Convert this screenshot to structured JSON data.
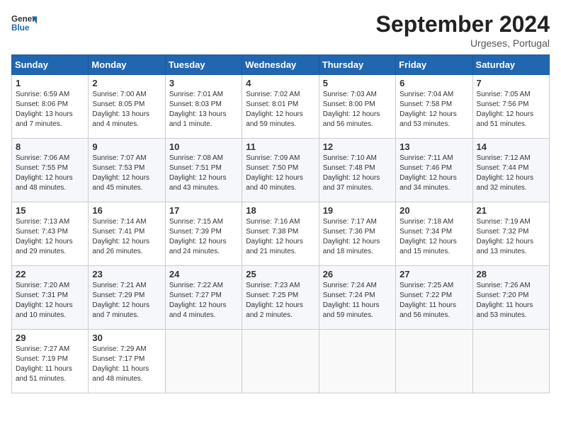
{
  "header": {
    "logo_line1": "General",
    "logo_line2": "Blue",
    "month_title": "September 2024",
    "location": "Urgeses, Portugal"
  },
  "days_of_week": [
    "Sunday",
    "Monday",
    "Tuesday",
    "Wednesday",
    "Thursday",
    "Friday",
    "Saturday"
  ],
  "weeks": [
    [
      {
        "day": "1",
        "sunrise": "Sunrise: 6:59 AM",
        "sunset": "Sunset: 8:06 PM",
        "daylight": "Daylight: 13 hours and 7 minutes."
      },
      {
        "day": "2",
        "sunrise": "Sunrise: 7:00 AM",
        "sunset": "Sunset: 8:05 PM",
        "daylight": "Daylight: 13 hours and 4 minutes."
      },
      {
        "day": "3",
        "sunrise": "Sunrise: 7:01 AM",
        "sunset": "Sunset: 8:03 PM",
        "daylight": "Daylight: 13 hours and 1 minute."
      },
      {
        "day": "4",
        "sunrise": "Sunrise: 7:02 AM",
        "sunset": "Sunset: 8:01 PM",
        "daylight": "Daylight: 12 hours and 59 minutes."
      },
      {
        "day": "5",
        "sunrise": "Sunrise: 7:03 AM",
        "sunset": "Sunset: 8:00 PM",
        "daylight": "Daylight: 12 hours and 56 minutes."
      },
      {
        "day": "6",
        "sunrise": "Sunrise: 7:04 AM",
        "sunset": "Sunset: 7:58 PM",
        "daylight": "Daylight: 12 hours and 53 minutes."
      },
      {
        "day": "7",
        "sunrise": "Sunrise: 7:05 AM",
        "sunset": "Sunset: 7:56 PM",
        "daylight": "Daylight: 12 hours and 51 minutes."
      }
    ],
    [
      {
        "day": "8",
        "sunrise": "Sunrise: 7:06 AM",
        "sunset": "Sunset: 7:55 PM",
        "daylight": "Daylight: 12 hours and 48 minutes."
      },
      {
        "day": "9",
        "sunrise": "Sunrise: 7:07 AM",
        "sunset": "Sunset: 7:53 PM",
        "daylight": "Daylight: 12 hours and 45 minutes."
      },
      {
        "day": "10",
        "sunrise": "Sunrise: 7:08 AM",
        "sunset": "Sunset: 7:51 PM",
        "daylight": "Daylight: 12 hours and 43 minutes."
      },
      {
        "day": "11",
        "sunrise": "Sunrise: 7:09 AM",
        "sunset": "Sunset: 7:50 PM",
        "daylight": "Daylight: 12 hours and 40 minutes."
      },
      {
        "day": "12",
        "sunrise": "Sunrise: 7:10 AM",
        "sunset": "Sunset: 7:48 PM",
        "daylight": "Daylight: 12 hours and 37 minutes."
      },
      {
        "day": "13",
        "sunrise": "Sunrise: 7:11 AM",
        "sunset": "Sunset: 7:46 PM",
        "daylight": "Daylight: 12 hours and 34 minutes."
      },
      {
        "day": "14",
        "sunrise": "Sunrise: 7:12 AM",
        "sunset": "Sunset: 7:44 PM",
        "daylight": "Daylight: 12 hours and 32 minutes."
      }
    ],
    [
      {
        "day": "15",
        "sunrise": "Sunrise: 7:13 AM",
        "sunset": "Sunset: 7:43 PM",
        "daylight": "Daylight: 12 hours and 29 minutes."
      },
      {
        "day": "16",
        "sunrise": "Sunrise: 7:14 AM",
        "sunset": "Sunset: 7:41 PM",
        "daylight": "Daylight: 12 hours and 26 minutes."
      },
      {
        "day": "17",
        "sunrise": "Sunrise: 7:15 AM",
        "sunset": "Sunset: 7:39 PM",
        "daylight": "Daylight: 12 hours and 24 minutes."
      },
      {
        "day": "18",
        "sunrise": "Sunrise: 7:16 AM",
        "sunset": "Sunset: 7:38 PM",
        "daylight": "Daylight: 12 hours and 21 minutes."
      },
      {
        "day": "19",
        "sunrise": "Sunrise: 7:17 AM",
        "sunset": "Sunset: 7:36 PM",
        "daylight": "Daylight: 12 hours and 18 minutes."
      },
      {
        "day": "20",
        "sunrise": "Sunrise: 7:18 AM",
        "sunset": "Sunset: 7:34 PM",
        "daylight": "Daylight: 12 hours and 15 minutes."
      },
      {
        "day": "21",
        "sunrise": "Sunrise: 7:19 AM",
        "sunset": "Sunset: 7:32 PM",
        "daylight": "Daylight: 12 hours and 13 minutes."
      }
    ],
    [
      {
        "day": "22",
        "sunrise": "Sunrise: 7:20 AM",
        "sunset": "Sunset: 7:31 PM",
        "daylight": "Daylight: 12 hours and 10 minutes."
      },
      {
        "day": "23",
        "sunrise": "Sunrise: 7:21 AM",
        "sunset": "Sunset: 7:29 PM",
        "daylight": "Daylight: 12 hours and 7 minutes."
      },
      {
        "day": "24",
        "sunrise": "Sunrise: 7:22 AM",
        "sunset": "Sunset: 7:27 PM",
        "daylight": "Daylight: 12 hours and 4 minutes."
      },
      {
        "day": "25",
        "sunrise": "Sunrise: 7:23 AM",
        "sunset": "Sunset: 7:25 PM",
        "daylight": "Daylight: 12 hours and 2 minutes."
      },
      {
        "day": "26",
        "sunrise": "Sunrise: 7:24 AM",
        "sunset": "Sunset: 7:24 PM",
        "daylight": "Daylight: 11 hours and 59 minutes."
      },
      {
        "day": "27",
        "sunrise": "Sunrise: 7:25 AM",
        "sunset": "Sunset: 7:22 PM",
        "daylight": "Daylight: 11 hours and 56 minutes."
      },
      {
        "day": "28",
        "sunrise": "Sunrise: 7:26 AM",
        "sunset": "Sunset: 7:20 PM",
        "daylight": "Daylight: 11 hours and 53 minutes."
      }
    ],
    [
      {
        "day": "29",
        "sunrise": "Sunrise: 7:27 AM",
        "sunset": "Sunset: 7:19 PM",
        "daylight": "Daylight: 11 hours and 51 minutes."
      },
      {
        "day": "30",
        "sunrise": "Sunrise: 7:29 AM",
        "sunset": "Sunset: 7:17 PM",
        "daylight": "Daylight: 11 hours and 48 minutes."
      },
      null,
      null,
      null,
      null,
      null
    ]
  ]
}
